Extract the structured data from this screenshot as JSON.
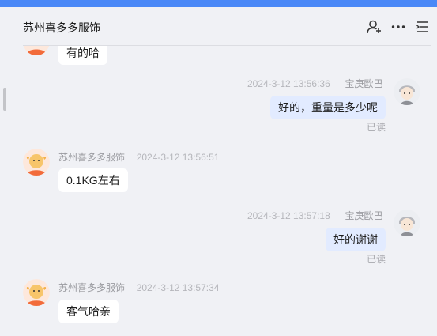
{
  "header": {
    "title": "苏州喜多多服饰"
  },
  "messages": [
    {
      "side": "left",
      "text": "有的哈"
    },
    {
      "side": "right",
      "time": "2024-3-12 13:56:36",
      "sender": "宝庚欧巴",
      "text": "好的，重量是多少呢",
      "status": "已读"
    },
    {
      "side": "left",
      "time": "2024-3-12 13:56:51",
      "sender": "苏州喜多多服饰",
      "text": "0.1KG左右"
    },
    {
      "side": "right",
      "time": "2024-3-12 13:57:18",
      "sender": "宝庚欧巴",
      "text": "好的谢谢",
      "status": "已读"
    },
    {
      "side": "left",
      "time": "2024-3-12 13:57:34",
      "sender": "苏州喜多多服饰",
      "text": "客气哈亲"
    }
  ],
  "colors": {
    "accent_bar": "#4a88f7",
    "background": "#f0f1f5",
    "bubble_self": "#e2ebff",
    "bubble_other": "#ffffff",
    "avatar_shop": "#f26b3a"
  },
  "icons": [
    "add-contact-icon",
    "more-icon",
    "list-menu-icon"
  ]
}
